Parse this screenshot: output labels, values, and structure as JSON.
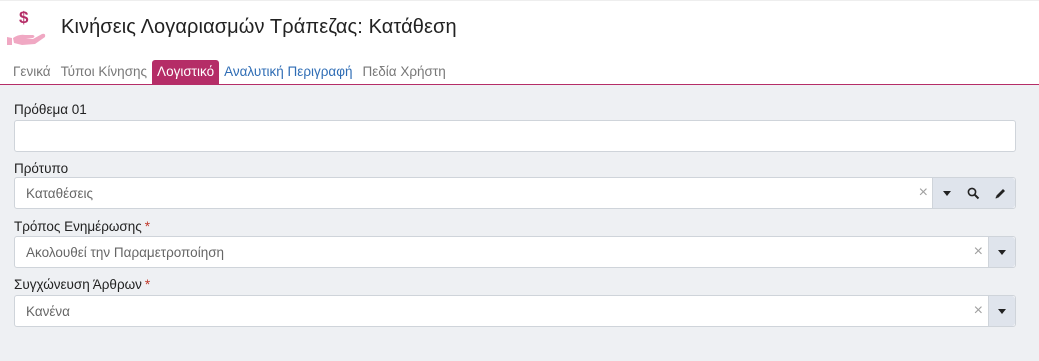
{
  "header": {
    "title": "Κινήσεις Λογαριασμών Τράπεζας: Κατάθεση",
    "icon": "money-hand-icon",
    "accent_color": "#b52d67"
  },
  "tabs": [
    {
      "label": "Γενικά",
      "state": "inactive"
    },
    {
      "label": "Τύποι Κίνησης",
      "state": "inactive"
    },
    {
      "label": "Λογιστικό",
      "state": "active"
    },
    {
      "label": "Αναλυτική Περιγραφή",
      "state": "link"
    },
    {
      "label": "Πεδία Χρήστη",
      "state": "inactive"
    }
  ],
  "form": {
    "prothema": {
      "label": "Πρόθεμα 01",
      "value": ""
    },
    "protypo": {
      "label": "Πρότυπο",
      "value": "Καταθέσεις"
    },
    "tropos": {
      "label": "Τρόπος Ενημέρωσης",
      "required": "*",
      "value": "Ακολουθεί την Παραμετροποίηση"
    },
    "sygxoneusi": {
      "label": "Συγχώνευση Άρθρων",
      "required": "*",
      "value": "Κανένα"
    }
  },
  "icons": {
    "clear": "×",
    "dropdown": "chevron-down-icon",
    "search": "search-icon",
    "edit": "pencil-icon"
  }
}
